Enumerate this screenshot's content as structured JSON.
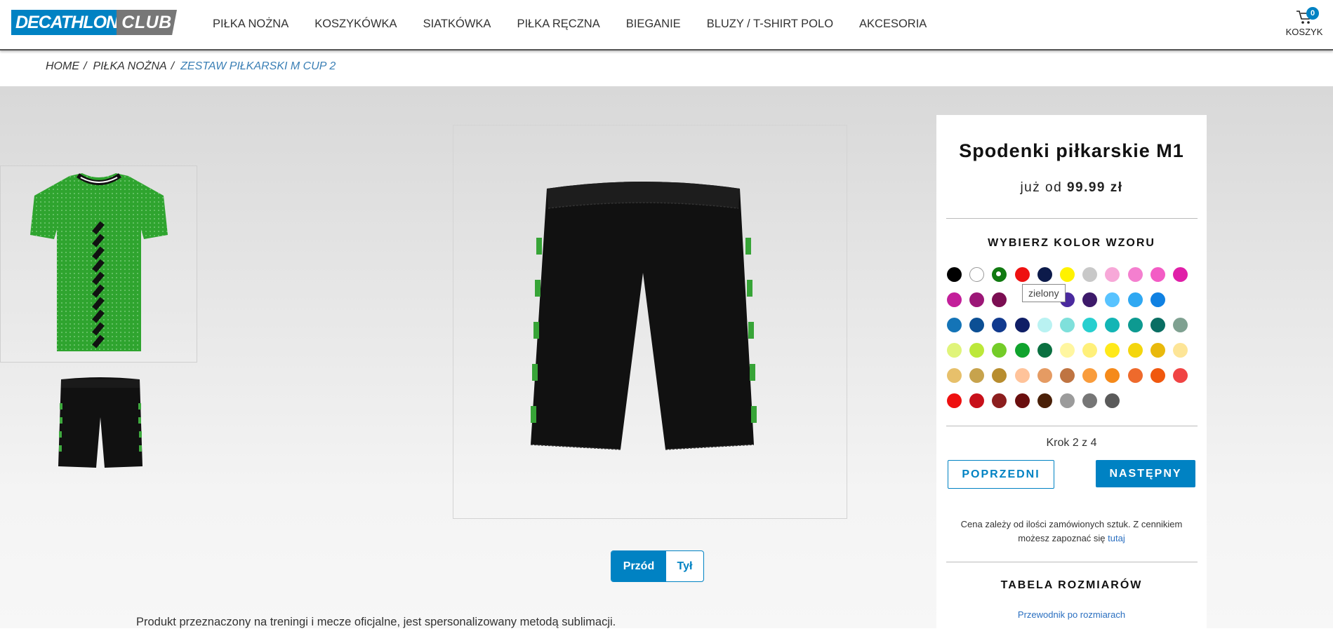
{
  "header": {
    "logo_main": "DECATHLON",
    "logo_club": "CLUB",
    "nav": [
      "PIŁKA NOŻNA",
      "KOSZYKÓWKA",
      "SIATKÓWKA",
      "PIŁKA RĘCZNA",
      "BIEGANIE",
      "BLUZY / T-SHIRT POLO",
      "AKCESORIA"
    ],
    "cart_label": "KOSZYK",
    "cart_count": "0"
  },
  "breadcrumb": {
    "home": "HOME",
    "category": "PIŁKA NOŻNA",
    "current": "ZESTAW PIŁKARSKI M CUP 2",
    "separator": "/"
  },
  "preview": {
    "view_front": "Przód",
    "view_back": "Tył"
  },
  "description": "Produkt przeznaczony na treningi i mecze oficjalne, jest spersonalizowany metodą sublimacji.",
  "panel": {
    "title": "Spodenki piłkarskie M1",
    "price_prefix": "już od",
    "price": "99.99 zł",
    "color_heading": "WYBIERZ KOLOR WZORU",
    "tooltip": "zielony",
    "step": "Krok 2 z 4",
    "prev_label": "POPRZEDNI",
    "next_label": "NASTĘPNY",
    "note_text": "Cena zależy od ilości zamówionych sztuk. Z cennikiem możesz zapoznać się",
    "note_link": "tutaj",
    "size_heading": "TABELA ROZMIARÓW",
    "size_link": "Przewodnik po rozmiarach"
  },
  "colors": {
    "accent": "#0082c3",
    "selected": "#117a11",
    "palette": [
      [
        "#000000",
        "#ffffff",
        "#117a11",
        "#ee1111",
        "#0c1a4a",
        "#fff200",
        "#c8c8c8",
        "#f7a8d8",
        "#f47fcf",
        "#f35cc5",
        "#e01fa8"
      ],
      [
        "#c31f9a",
        "#9c1777",
        "#7b0e52",
        "#7a1f6a",
        "#7a3fc0",
        "#4a2a9e",
        "#3d1a6a",
        "#58c3ff",
        "#2fa8f2",
        "#1081e2"
      ],
      [
        "#1474b7",
        "#0c4f94",
        "#113a8e",
        "#0f1e66",
        "#b9f2f2",
        "#7fe0db",
        "#27cfcf",
        "#13b5b5",
        "#0d9a91",
        "#0a6e63",
        "#7fa191"
      ],
      [
        "#e0f47a",
        "#bce83a",
        "#74cc28",
        "#10a32d",
        "#0a7040",
        "#fff6a0",
        "#fff07a",
        "#ffe91a",
        "#f4d60d",
        "#e9b90c",
        "#fde597"
      ],
      [
        "#e7c06b",
        "#c7a34d",
        "#b88d2f",
        "#ffc39a",
        "#e59b63",
        "#bf7442",
        "#f99c3c",
        "#f58a1a",
        "#ee6a2c",
        "#f0580e",
        "#f04444"
      ],
      [
        "#ee1010",
        "#c8101a",
        "#8c1e1e",
        "#6a0e0e",
        "#4a2008",
        "#9b9b9b",
        "#767676",
        "#5a5a5a"
      ]
    ]
  }
}
